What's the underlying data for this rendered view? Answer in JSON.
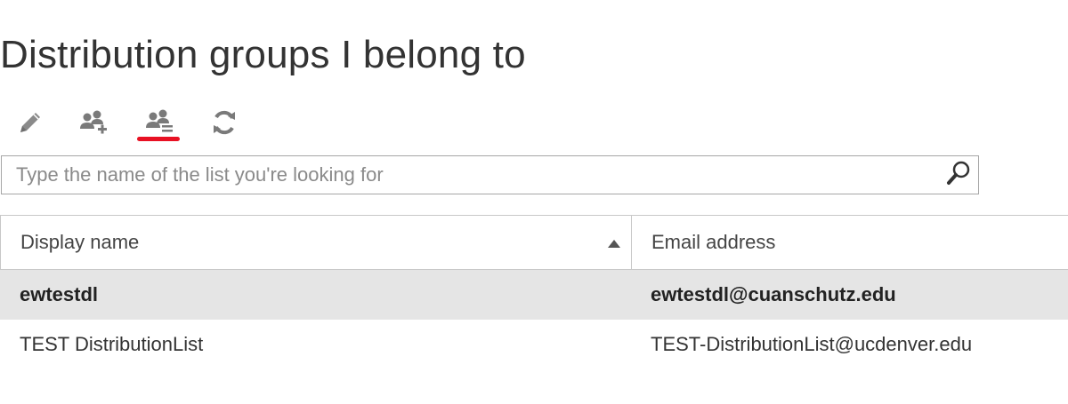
{
  "page": {
    "title": "Distribution groups I belong to"
  },
  "toolbar": {
    "items": [
      {
        "name": "edit",
        "icon": "pencil-icon"
      },
      {
        "name": "join",
        "icon": "add-group-icon"
      },
      {
        "name": "leave",
        "icon": "group-list-icon",
        "active": true
      },
      {
        "name": "refresh",
        "icon": "refresh-icon"
      }
    ],
    "active_indicator_color": "#e81123"
  },
  "search": {
    "placeholder": "Type the name of the list you're looking for",
    "value": "",
    "icon": "search-icon"
  },
  "table": {
    "columns": [
      {
        "label": "Display name",
        "sorted": "ascending"
      },
      {
        "label": "Email address"
      }
    ],
    "rows": [
      {
        "display_name": "ewtestdl",
        "email": "ewtestdl@cuanschutz.edu",
        "selected": true
      },
      {
        "display_name": "TEST DistributionList",
        "email": "TEST-DistributionList@ucdenver.edu",
        "selected": false
      }
    ]
  },
  "colors": {
    "selected_row_bg": "#e5e5e5",
    "border": "#c8c8c8",
    "text": "#333333",
    "icon": "#777777"
  }
}
